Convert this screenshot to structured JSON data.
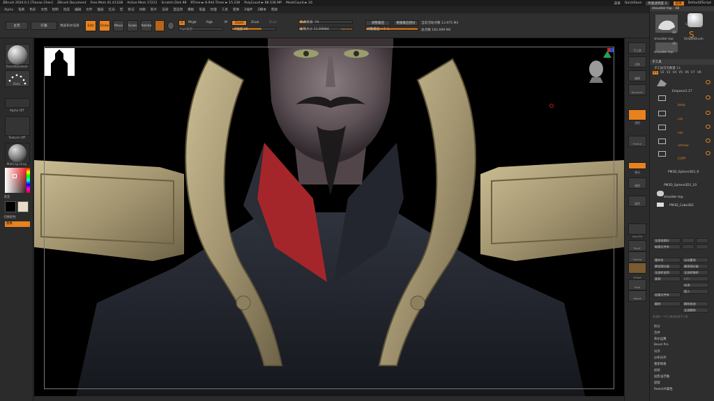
{
  "titlebar": {
    "app": "ZBrush 2024.0.1 [Tianao Chen]",
    "doc": "ZBrush Document",
    "free_mem": "Free Mem 41.411GB",
    "active_mem": "Active Mem 17212",
    "scratch": "Scratch Disk 98",
    "rtime": "RTime ► 8.944 Timer ► 15.236",
    "polycount": "PolyCount ► 88.536 MP",
    "meshcount": "MeshCount ► 16",
    "right_icon": "菜单",
    "quicksave": "QuickSave",
    "transparency": "界面透明度 0",
    "menu_btn": "菜单",
    "script": "DefaultZScript"
  },
  "menubar": [
    "Alpha",
    "笔刷",
    "色彩",
    "文档",
    "绘制",
    "动态",
    "编辑",
    "文件",
    "图层",
    "红光",
    "宏",
    "标记",
    "材质",
    "影片",
    "渲染",
    "首选项",
    "模板",
    "笔画",
    "纹理",
    "工具",
    "变换",
    "Z插件",
    "Z脚本",
    "帮助"
  ],
  "shelf": {
    "home": "主页",
    "lightbox": "灯箱",
    "spotlight": "预览布尔渲染",
    "edit": "Edit",
    "draw": "Draw",
    "move": "Move",
    "scale": "Scale",
    "rotate": "Rotate",
    "a": "A",
    "mrgb": "Mrgb",
    "rgb": "Rgb",
    "m": "M",
    "zadd": "Zadd",
    "zsub": "Zsub",
    "zcut": "Zcut",
    "rgb_intensity": "Rgb强度",
    "z_intensity": "Z强度 68",
    "focal_shift": "焦点衰减 -74",
    "draw_size": "绘制大小 11.69084",
    "dynamic": "Dynamic",
    "active_points": "当前活动点数 13.975 Mil",
    "total_points": "总点数 182.699 Mil",
    "adjust_last": "调整最后",
    "replay_last": "重播最后相对",
    "adjust_last_val": "调整最后一个 1"
  },
  "lefttray": {
    "brush": "DamStandard",
    "stroke": "Dots",
    "alpha": "Alpha Off",
    "texture": "Texture Off",
    "material": "MatCap Gray",
    "gradient": "渐变",
    "switch_color": "切换颜色",
    "alternate": "替换"
  },
  "rtool": {
    "labels": [
      "子工具",
      "对称",
      "编辑",
      "Dynamic",
      "透视",
      "Frame",
      "移动",
      "缩放",
      "旋转",
      "Line Fill",
      "PolyF",
      "Transp",
      "Ghost",
      "Solo",
      "Xpose"
    ]
  },
  "rpal": {
    "tool_title": "shoulder·top · 48",
    "cylinder": "Cylinder3D",
    "simple": "SimpleBrush",
    "tool1": "shoulder·top",
    "tool2": "shoulder·top",
    "tool1_count": "48",
    "tool2_count": "35",
    "subtool_hdr": "子工具",
    "visible_count": "子工具可见数量 13",
    "tabs": [
      "V1",
      "V2",
      "V3",
      "V4",
      "V5",
      "V6",
      "V7",
      "V8"
    ],
    "subtools": [
      {
        "name": "Emperor2.17"
      },
      {
        "name": "body"
      },
      {
        "name": "cos"
      },
      {
        "name": "hat"
      },
      {
        "name": "armour"
      },
      {
        "name": "COPY"
      },
      {
        "name": "PM3D_Sphere3D1_9"
      },
      {
        "name": "PM3D_Sphere3D1_10"
      },
      {
        "name": "shoulder·top"
      },
      {
        "name": "PM3D_Cube3D1"
      }
    ],
    "btn_all_low": "全部低细分",
    "btn_new_folder": "新建文件夹",
    "btn_rename": "重命名",
    "btn_auto_reorder": "自动重排",
    "btn_all_low2": "最低细分级",
    "btn_all_high": "最高细分级",
    "btn_all_copy": "全部转变到",
    "btn_all_move": "全部转移转",
    "btn_copy": "复制",
    "btn_paste": "Edit",
    "btn_append": "向进",
    "btn_insert": "插入",
    "btn_delete": "删除",
    "btn_del_other": "删除其他",
    "btn_del_all": "全部删除",
    "btn_create_folder": "创建文件夹",
    "hint": "将选择一个子工具将存放子工具",
    "list": [
      "拆分",
      "合并",
      "布尔运算",
      "Bevel Pro",
      "对齐",
      "分布对齐",
      "重新网格",
      "投射",
      "投影浅浮雕",
      "提取",
      "Redshift属性"
    ]
  },
  "colors": {
    "accent": "#e8821e",
    "gold": "#b3a57a",
    "robe": "#20232b",
    "collar": "#a5262a"
  }
}
